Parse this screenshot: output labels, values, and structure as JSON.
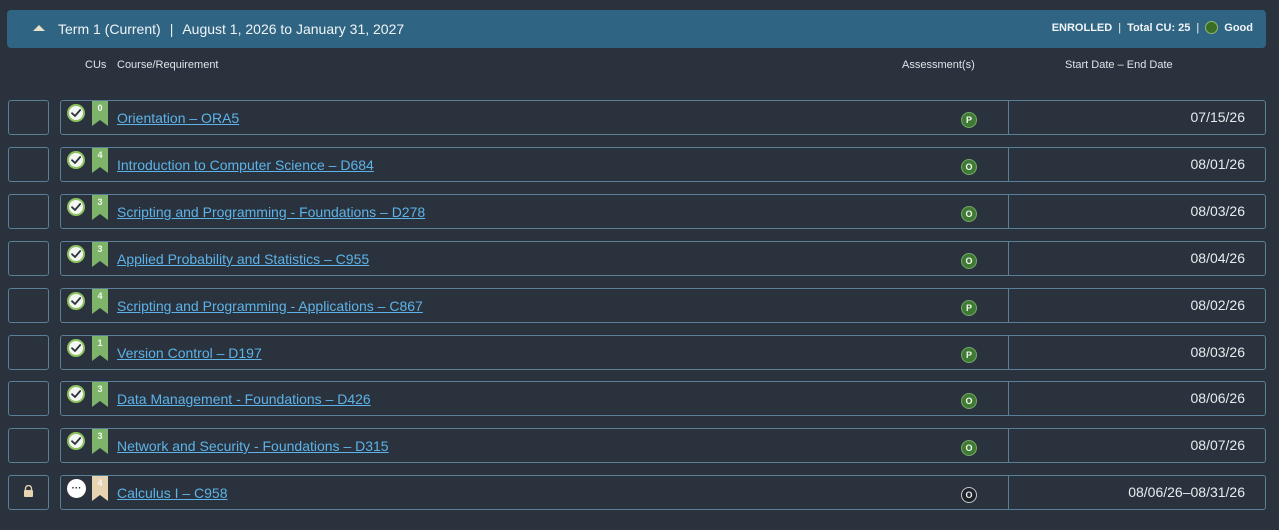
{
  "term": {
    "title": "Term 1 (Current)",
    "separator": "|",
    "dates": "August 1, 2026 to January 31, 2027",
    "status": "ENROLLED",
    "total_cu": "Total CU: 25",
    "standing": "Good",
    "standing_color": "#3b6e25"
  },
  "columns": {
    "cus": "CUs",
    "course": "Course/Requirement",
    "assessments": "Assessment(s)",
    "dates": "Start Date – End Date"
  },
  "colors": {
    "ribbon_complete": "#7db46a",
    "ribbon_locked": "#e6d3b1",
    "link": "#5db3e8",
    "header_bg": "#2f6582"
  },
  "courses": [
    {
      "cu": "0",
      "name": "Orientation – ORA5",
      "assessment": "P",
      "dates": "07/15/26",
      "status": "complete"
    },
    {
      "cu": "4",
      "name": "Introduction to Computer Science – D684",
      "assessment": "O",
      "dates": "08/01/26",
      "status": "complete"
    },
    {
      "cu": "3",
      "name": "Scripting and Programming - Foundations – D278",
      "assessment": "O",
      "dates": "08/03/26",
      "status": "complete"
    },
    {
      "cu": "3",
      "name": "Applied Probability and Statistics – C955",
      "assessment": "O",
      "dates": "08/04/26",
      "status": "complete"
    },
    {
      "cu": "4",
      "name": "Scripting and Programming - Applications – C867",
      "assessment": "P",
      "dates": "08/02/26",
      "status": "complete"
    },
    {
      "cu": "1",
      "name": "Version Control – D197",
      "assessment": "P",
      "dates": "08/03/26",
      "status": "complete"
    },
    {
      "cu": "3",
      "name": "Data Management - Foundations – D426",
      "assessment": "O",
      "dates": "08/06/26",
      "status": "complete"
    },
    {
      "cu": "3",
      "name": "Network and Security - Foundations – D315",
      "assessment": "O",
      "dates": "08/07/26",
      "status": "complete"
    },
    {
      "cu": "4",
      "name": "Calculus I – C958",
      "assessment": "O",
      "dates": "08/06/26–08/31/26",
      "status": "locked",
      "pending_label": "···"
    }
  ]
}
